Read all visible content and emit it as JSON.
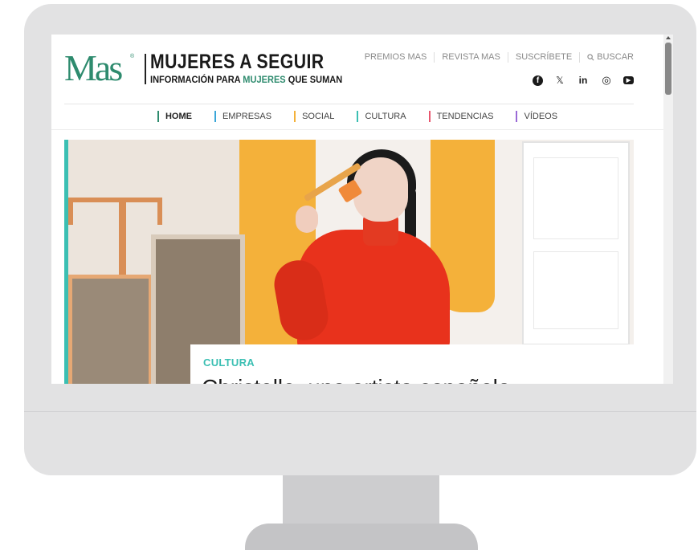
{
  "site": {
    "logo_mark": "Mas",
    "logo_reg": "®",
    "title": "MUJERES A SEGUIR",
    "subtitle_before": "INFORMACIÓN PARA ",
    "subtitle_highlight": "MUJERES",
    "subtitle_after": " QUE SUMAN"
  },
  "toplinks": [
    "PREMIOS MAS",
    "REVISTA MAS",
    "SUSCRÍBETE",
    "BUSCAR"
  ],
  "social_icons": [
    "facebook-icon",
    "x-icon",
    "linkedin-icon",
    "instagram-icon",
    "youtube-icon"
  ],
  "social_glyphs": {
    "facebook": "f",
    "x": "𝕏",
    "linkedin": "in",
    "instagram": "◎",
    "youtube": "▶"
  },
  "nav": [
    {
      "label": "HOME",
      "color": "#2e8b6e",
      "active": true
    },
    {
      "label": "EMPRESAS",
      "color": "#3aa6d8"
    },
    {
      "label": "SOCIAL",
      "color": "#f4b13a"
    },
    {
      "label": "CULTURA",
      "color": "#3bbfb3"
    },
    {
      "label": "TENDENCIAS",
      "color": "#e8566e"
    },
    {
      "label": "VÍDEOS",
      "color": "#9a6ad6"
    }
  ],
  "hero": {
    "category": "CULTURA",
    "headline": "Christelle, una artista española"
  },
  "colors": {
    "brand": "#2e8b6e",
    "accent": "#3bbfb3"
  }
}
